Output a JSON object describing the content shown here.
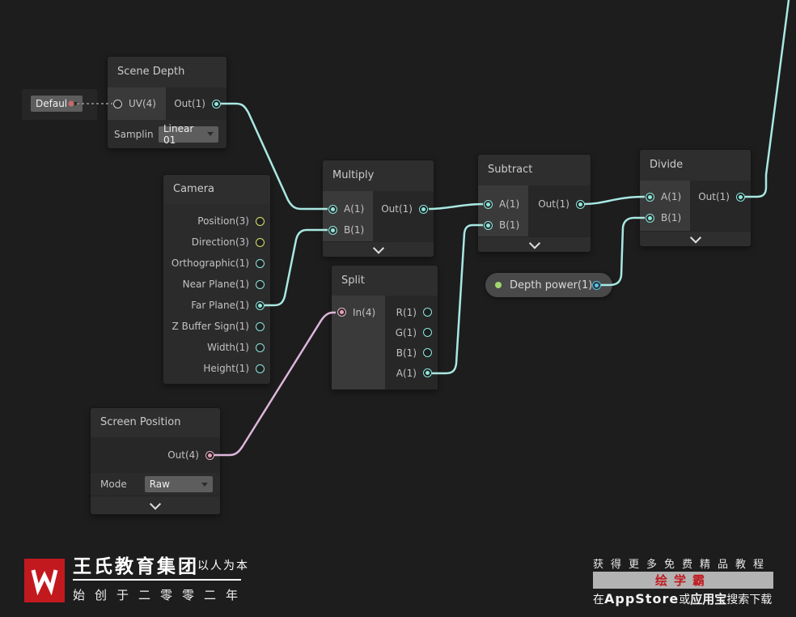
{
  "colors": {
    "background": "#1d1d1e",
    "wire_teal": "#a9e8e2",
    "wire_pink": "#ddb6da",
    "dash_gray": "#9a9a9a",
    "dot_red": "#c96a6a",
    "brand_red": "#c2191f"
  },
  "graph": {
    "default_dropdown": {
      "label": "Defaul"
    },
    "nodes": {
      "scene_depth": {
        "title": "Scene Depth",
        "input": "UV(4)",
        "output": "Out(1)",
        "sampling_label": "Samplin",
        "sampling_value": "Linear 01"
      },
      "camera": {
        "title": "Camera",
        "outputs": [
          "Position(3)",
          "Direction(3)",
          "Orthographic(1)",
          "Near Plane(1)",
          "Far Plane(1)",
          "Z Buffer Sign(1)",
          "Width(1)",
          "Height(1)"
        ]
      },
      "multiply": {
        "title": "Multiply",
        "input_a": "A(1)",
        "input_b": "B(1)",
        "output": "Out(1)"
      },
      "split": {
        "title": "Split",
        "input": "In(4)",
        "outputs": [
          "R(1)",
          "G(1)",
          "B(1)",
          "A(1)"
        ]
      },
      "subtract": {
        "title": "Subtract",
        "input_a": "A(1)",
        "input_b": "B(1)",
        "output": "Out(1)"
      },
      "divide": {
        "title": "Divide",
        "input_a": "A(1)",
        "input_b": "B(1)",
        "output": "Out(1)"
      },
      "screen_position": {
        "title": "Screen Position",
        "output": "Out(4)",
        "mode_label": "Mode",
        "mode_value": "Raw"
      },
      "depth_power": {
        "label": "Depth power(1)"
      }
    }
  },
  "footer": {
    "left": {
      "company": "王氏教育集团",
      "motto": "以人为本",
      "founded": "始创于二零零二年"
    },
    "right": {
      "tagline": "获得更多免费精品教程",
      "app_name": "绘学霸",
      "download_pre": "在",
      "download_store1": "AppStore",
      "download_or": "或",
      "download_store2": "应用宝",
      "download_post": "搜索下载"
    }
  }
}
